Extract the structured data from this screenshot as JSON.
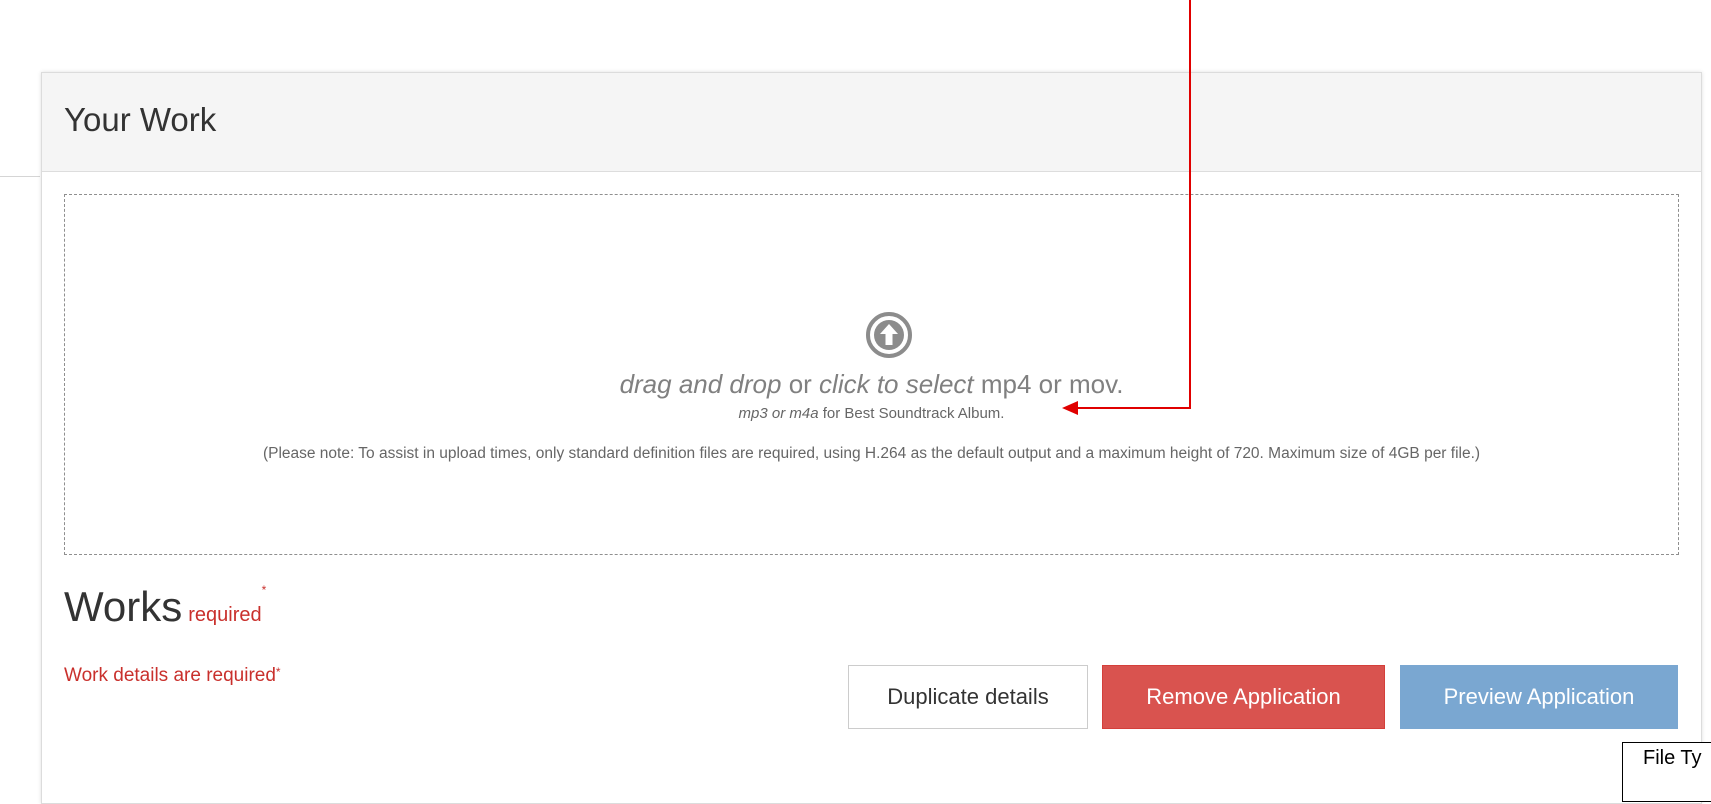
{
  "panel": {
    "title": "Your Work"
  },
  "dropzone": {
    "icon": "upload-arrow-circle-icon",
    "line1_italic_a": "drag and drop",
    "line1_plain_a": " or ",
    "line1_italic_b": "click to select",
    "line1_plain_b": " mp4 or mov.",
    "line2_italic": "mp3 or m4a",
    "line2_plain": " for Best Soundtrack Album.",
    "note": "(Please note: To assist in upload times, only standard definition files are required, using H.264 as the default output and a maximum height of 720. Maximum size of 4GB per file.)"
  },
  "works": {
    "heading": "Works",
    "required_label": "required",
    "asterisk": "*",
    "error_text": "Work details are required",
    "error_asterisk": "*"
  },
  "buttons": {
    "duplicate": "Duplicate details",
    "remove": "Remove Application",
    "preview": "Preview Application"
  },
  "annotation": {
    "callout_text": "File Ty"
  },
  "colors": {
    "danger": "#d9534f",
    "primary_muted": "#7aa7d1",
    "required_red": "#c9302c",
    "annotation_red": "#e00000"
  }
}
